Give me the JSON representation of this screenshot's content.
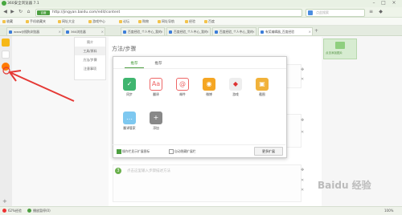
{
  "window": {
    "title": "360安全浏览器 7.1"
  },
  "nav": {
    "badge": "百度",
    "url": "http://jingyan.baidu.com/edit/content",
    "search_placeholder": "点此搜索"
  },
  "bookmarks": [
    "收藏",
    "手机收藏夹",
    "网址大全",
    "游戏中心",
    "论坛",
    "购物",
    "网址导航",
    "经验",
    "百度"
  ],
  "tabs": [
    {
      "label": "www@搜狗浏览器"
    },
    {
      "label": "360浏览器"
    },
    {
      "label": "百度经验_个人中心_我的"
    },
    {
      "label": "百度经验_个人中心_我的"
    },
    {
      "label": "百度经验_个人中心_我的"
    },
    {
      "label": "有奖编辑器_百度经验"
    }
  ],
  "toc": {
    "items": [
      "简介",
      "工具/原料",
      "方法/步骤",
      "注意事项"
    ]
  },
  "main": {
    "heading": "方法/步骤",
    "placeholder": "点击这里输入步骤描述方法",
    "step3": "3"
  },
  "right": {
    "image_label": "点击添加图片"
  },
  "popup": {
    "tab_active": "推荐",
    "tab_other": "推荐",
    "apps": [
      {
        "label": "同步",
        "icon": "shield-icon"
      },
      {
        "label": "翻译",
        "icon": "translate-icon"
      },
      {
        "label": "邮件",
        "icon": "mail-icon"
      },
      {
        "label": "微博",
        "icon": "weibo-icon"
      },
      {
        "label": "游戏",
        "icon": "game-icon"
      },
      {
        "label": "截图",
        "icon": "screenshot-icon"
      },
      {
        "label": "翻译管家",
        "icon": "chat-icon"
      },
      {
        "label": "添加",
        "icon": "plus-icon"
      }
    ],
    "footer_check1": "操作栏显示扩展图标",
    "footer_check2": "自动隐藏扩展栏",
    "more_button": "更多扩展"
  },
  "status": {
    "left1": "62%经验",
    "left2": "播放暂停(0)",
    "right": "100%"
  },
  "watermark": "Baidu 经验",
  "colors": {
    "accent": "#4c9f40",
    "arrow": "#e53935"
  }
}
